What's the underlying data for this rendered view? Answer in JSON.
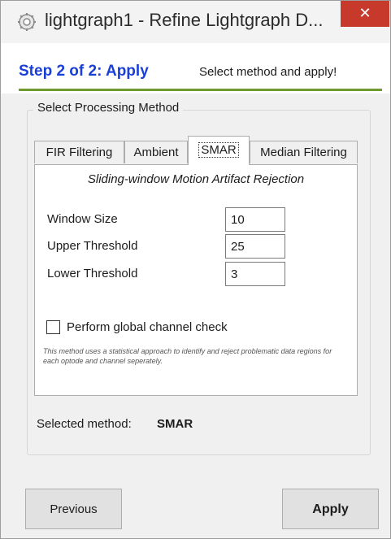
{
  "window": {
    "title": "lightgraph1 - Refine Lightgraph D...",
    "close_label": "✕"
  },
  "header": {
    "step": "Step 2 of 2: Apply",
    "hint": "Select method and apply!"
  },
  "group": {
    "legend": "Select Processing Method"
  },
  "tabs": [
    {
      "label": "FIR Filtering"
    },
    {
      "label": "Ambient"
    },
    {
      "label": "SMAR"
    },
    {
      "label": "Median Filtering"
    }
  ],
  "panel": {
    "subtitle": "Sliding-window Motion Artifact Rejection",
    "fields": [
      {
        "label": "Window Size",
        "value": "10"
      },
      {
        "label": "Upper Threshold",
        "value": "25"
      },
      {
        "label": "Lower Threshold",
        "value": "3"
      }
    ],
    "checkbox_label": "Perform global channel check",
    "checkbox_checked": false,
    "description": "This method uses a statistical approach to identify and reject problematic data regions for each optode and channel seperately."
  },
  "selection": {
    "label": "Selected method:",
    "value": "SMAR"
  },
  "buttons": {
    "previous": "Previous",
    "apply": "Apply"
  },
  "colors": {
    "step_blue": "#1a3fd6",
    "accent_green": "#6e9a2e",
    "close_red": "#c7392b"
  }
}
